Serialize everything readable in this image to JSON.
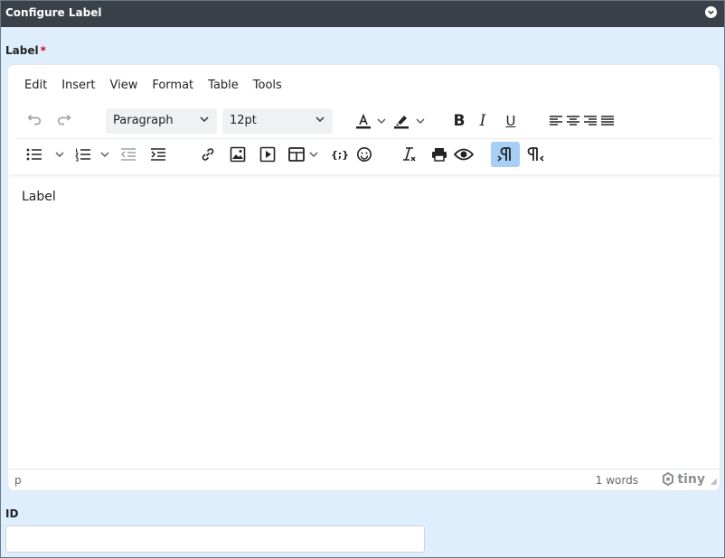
{
  "window": {
    "title": "Configure Label"
  },
  "label_field": {
    "label": "Label",
    "required_mark": "*"
  },
  "editor": {
    "menu": [
      "Edit",
      "Insert",
      "View",
      "Format",
      "Table",
      "Tools"
    ],
    "block_format": "Paragraph",
    "font_size": "12pt",
    "content_text": "Label",
    "status": {
      "path": "p",
      "word_count": "1 words",
      "brand": "tiny"
    }
  },
  "id_field": {
    "label": "ID",
    "value": "",
    "placeholder": ""
  },
  "colors": {
    "titlebar": "#3a4149",
    "background": "#dfeefd",
    "active_button": "#a6cff5"
  }
}
